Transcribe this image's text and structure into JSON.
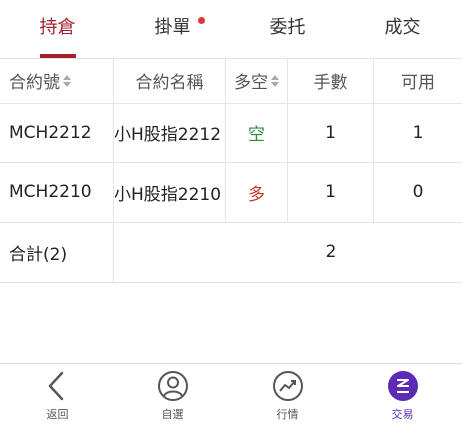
{
  "tabs": [
    {
      "label": "持倉",
      "active": true
    },
    {
      "label": "掛單",
      "has_dot": true
    },
    {
      "label": "委托"
    },
    {
      "label": "成交"
    }
  ],
  "table": {
    "headers": [
      "合約號",
      "合約名稱",
      "多空",
      "手數",
      "可用"
    ],
    "rows": [
      {
        "code": "MCH2212",
        "name": "小H股指2212",
        "side": "空",
        "lots": "1",
        "avail": "1"
      },
      {
        "code": "MCH2210",
        "name": "小H股指2210",
        "side": "多",
        "lots": "1",
        "avail": "0"
      }
    ],
    "total_label": "合計(2)",
    "total_value": "2"
  },
  "bottom_nav": [
    {
      "label": "返回",
      "icon": "back-chevron-icon"
    },
    {
      "label": "自選",
      "icon": "user-circle-icon"
    },
    {
      "label": "行情",
      "icon": "trend-chart-icon"
    },
    {
      "label": "交易",
      "icon": "trade-logo-icon",
      "active": true
    }
  ],
  "colors": {
    "accent": "#a31f2b",
    "long": "#c0392b",
    "short": "#2e8b3a",
    "nav_active": "#5b2bb5"
  }
}
